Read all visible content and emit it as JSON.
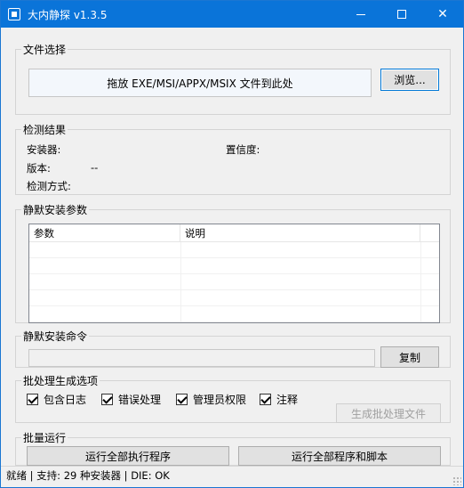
{
  "window": {
    "title": "大内静探 v1.3.5"
  },
  "file_select": {
    "legend": "文件选择",
    "drop_text": "拖放 EXE/MSI/APPX/MSIX 文件到此处",
    "browse_label": "浏览..."
  },
  "detect": {
    "legend": "检测结果",
    "installer_label": "安装器:",
    "confidence_label": "置信度:",
    "version_label": "版本:",
    "version_value": "--",
    "method_label": "检测方式:"
  },
  "params": {
    "legend": "静默安装参数",
    "columns": [
      "参数",
      "说明"
    ]
  },
  "command": {
    "legend": "静默安装命令",
    "value": "",
    "copy_label": "复制"
  },
  "batch_options": {
    "legend": "批处理生成选项",
    "options": [
      {
        "label": "包含日志",
        "checked": true
      },
      {
        "label": "错误处理",
        "checked": true
      },
      {
        "label": "管理员权限",
        "checked": true
      },
      {
        "label": "注释",
        "checked": true
      }
    ],
    "generate_label": "生成批处理文件"
  },
  "batch_run": {
    "legend": "批量运行",
    "run_all_label": "运行全部执行程序",
    "run_all_scripts_label": "运行全部程序和脚本"
  },
  "status": {
    "text": "就绪 | 支持: 29 种安装器 | DIE: OK"
  },
  "colors": {
    "titlebar": "#0a74d9",
    "accent": "#0078d7"
  }
}
